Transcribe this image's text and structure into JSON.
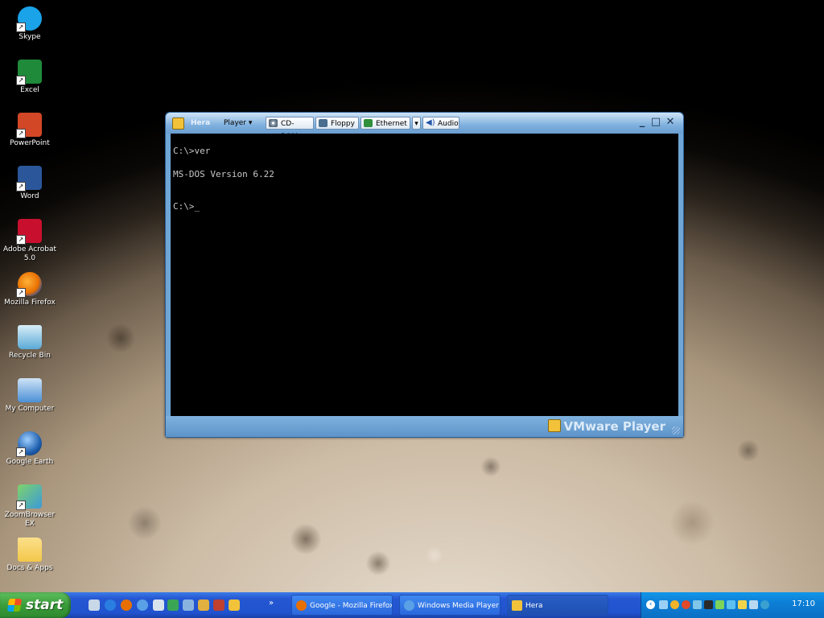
{
  "desktop": {
    "icons": [
      {
        "label": "Skype",
        "icon": "skype-icon",
        "color": "#1aa3e8"
      },
      {
        "label": "Excel",
        "icon": "excel-icon",
        "color": "#1f8a3a"
      },
      {
        "label": "PowerPoint",
        "icon": "powerpoint-icon",
        "color": "#d24726"
      },
      {
        "label": "Word",
        "icon": "word-icon",
        "color": "#2b579a"
      },
      {
        "label": "Adobe Acrobat 5.0",
        "icon": "acrobat-icon",
        "color": "#c8102e"
      },
      {
        "label": "Mozilla Firefox",
        "icon": "firefox-icon",
        "color": "#e76f00"
      },
      {
        "label": "Recycle Bin",
        "icon": "recycle-bin-icon",
        "color": "#5aa9d6"
      },
      {
        "label": "My Computer",
        "icon": "my-computer-icon",
        "color": "#4b8fd6"
      },
      {
        "label": "Google Earth",
        "icon": "google-earth-icon",
        "color": "#1f5fae"
      },
      {
        "label": "ZoomBrowser EX",
        "icon": "zoombrowser-icon",
        "color": "#3a9ad9"
      },
      {
        "label": "Docs & Apps",
        "icon": "folder-icon",
        "color": "#f3c74a"
      }
    ]
  },
  "vmware": {
    "title": "Hera",
    "menu_player": "Player",
    "devices": {
      "cdrom": "CD-ROM",
      "floppy": "Floppy",
      "ethernet": "Ethernet",
      "audio": "Audio"
    },
    "controls": {
      "minimize": "_",
      "maximize": "□",
      "close": "✕"
    },
    "console_lines": [
      "C:\\>ver",
      "MS-DOS Version 6.22",
      "C:\\>_"
    ],
    "brand": "VMware Player"
  },
  "taskbar": {
    "start_label": "start",
    "tasks": [
      {
        "label": "Google - Mozilla Firefox",
        "icon": "firefox-icon",
        "color": "#e76f00"
      },
      {
        "label": "Windows Media Player",
        "icon": "media-player-icon",
        "color": "#5aa0e6"
      },
      {
        "label": "Hera",
        "icon": "vmware-icon",
        "color": "#f2c23a"
      }
    ],
    "clock": "17:10",
    "overflow_chevron": "»"
  }
}
